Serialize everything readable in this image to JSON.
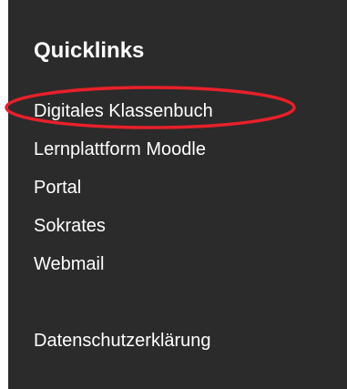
{
  "quicklinks": {
    "heading": "Quicklinks",
    "items": [
      {
        "label": "Digitales Klassenbuch"
      },
      {
        "label": "Lernplattform Moodle"
      },
      {
        "label": "Portal"
      },
      {
        "label": "Sokrates"
      },
      {
        "label": "Webmail"
      }
    ],
    "footer_link": "Datenschutzerklärung"
  },
  "colors": {
    "panel_background": "#2b2b2b",
    "text": "#ffffff",
    "annotation": "#e8202a"
  }
}
